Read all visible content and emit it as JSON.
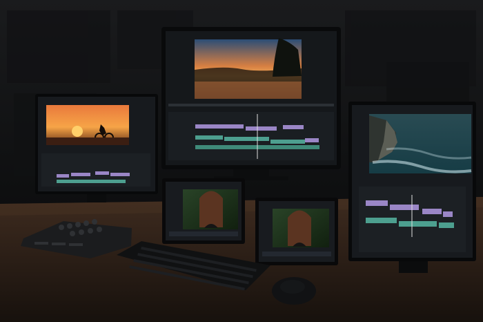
{
  "scene": {
    "description_type": "editing-studio-desk-photo",
    "objects": [
      "back-wall-acoustic-panels",
      "wooden-desk",
      "center-monitor",
      "left-monitor",
      "right-monitor",
      "left-tablet-display",
      "right-tablet-display",
      "control-surface",
      "keyboard",
      "mouse"
    ],
    "colors": {
      "wall": "#151617",
      "panel": "#101112",
      "desk": "#2a1d15",
      "desk_light": "#3d2a1e",
      "screen_bg": "#15181b",
      "timeline_purple": "#9a86c6",
      "timeline_teal": "#4d9f8f",
      "sunset_orange": "#f1a04b",
      "sky_blue": "#2d5b8b",
      "ocean_teal": "#2f6f7d"
    },
    "screens": {
      "center_preview": "lake-sunset",
      "left_preview": "cyclist-sunset",
      "right_preview": "ocean-cliffs",
      "tablet_left_preview": "woman-portrait-forest",
      "tablet_right_preview": "woman-portrait-forest"
    }
  }
}
